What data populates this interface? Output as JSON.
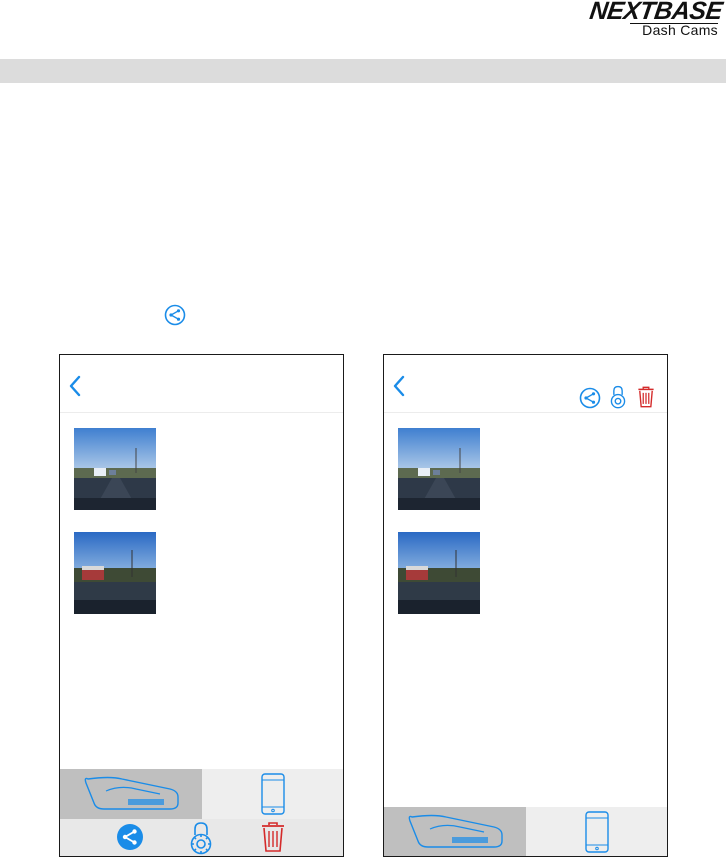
{
  "brand": {
    "name": "NEXTBASE",
    "tagline": "Dash Cams"
  },
  "icons": {
    "share": "share-icon",
    "protect": "lock-gear-icon",
    "delete": "trash-icon",
    "back": "chevron-left-icon",
    "camera_tab": "dashcam-icon",
    "phone_tab": "smartphone-icon"
  },
  "colors": {
    "accent": "#1a8ce8",
    "danger": "#d42a2a",
    "tab_active": "#bfbfbf",
    "tab_inactive": "#eeeeee",
    "header_bar": "#dcdcdc"
  },
  "screens": [
    {
      "id": "before",
      "thumbnails": 2,
      "top_actions_visible": false,
      "bottom_actions_visible": true
    },
    {
      "id": "after",
      "thumbnails": 2,
      "top_actions_visible": true,
      "bottom_actions_visible": false
    }
  ]
}
